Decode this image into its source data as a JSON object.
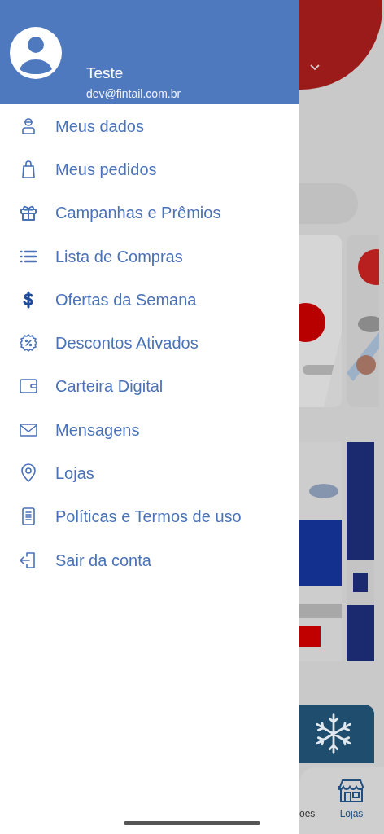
{
  "drawer": {
    "user": {
      "name": "Teste",
      "email": "dev@fintail.com.br"
    },
    "items": [
      {
        "kind": "profile",
        "label": "Meus dados"
      },
      {
        "kind": "bag",
        "label": "Meus pedidos"
      },
      {
        "kind": "gift",
        "label": "Campanhas e Prêmios"
      },
      {
        "kind": "list",
        "label": "Lista de Compras"
      },
      {
        "kind": "dollar",
        "label": "Ofertas da Semana"
      },
      {
        "kind": "discount",
        "label": "Descontos Ativados"
      },
      {
        "kind": "wallet",
        "label": "Carteira Digital"
      },
      {
        "kind": "mail",
        "label": "Mensagens"
      },
      {
        "kind": "pin",
        "label": "Lojas"
      },
      {
        "kind": "document",
        "label": "Políticas e Termos de uso"
      },
      {
        "kind": "logout",
        "label": "Sair da conta"
      }
    ]
  },
  "background": {
    "tab_bar": [
      {
        "label": "ões"
      },
      {
        "label": "Lojas"
      }
    ]
  }
}
